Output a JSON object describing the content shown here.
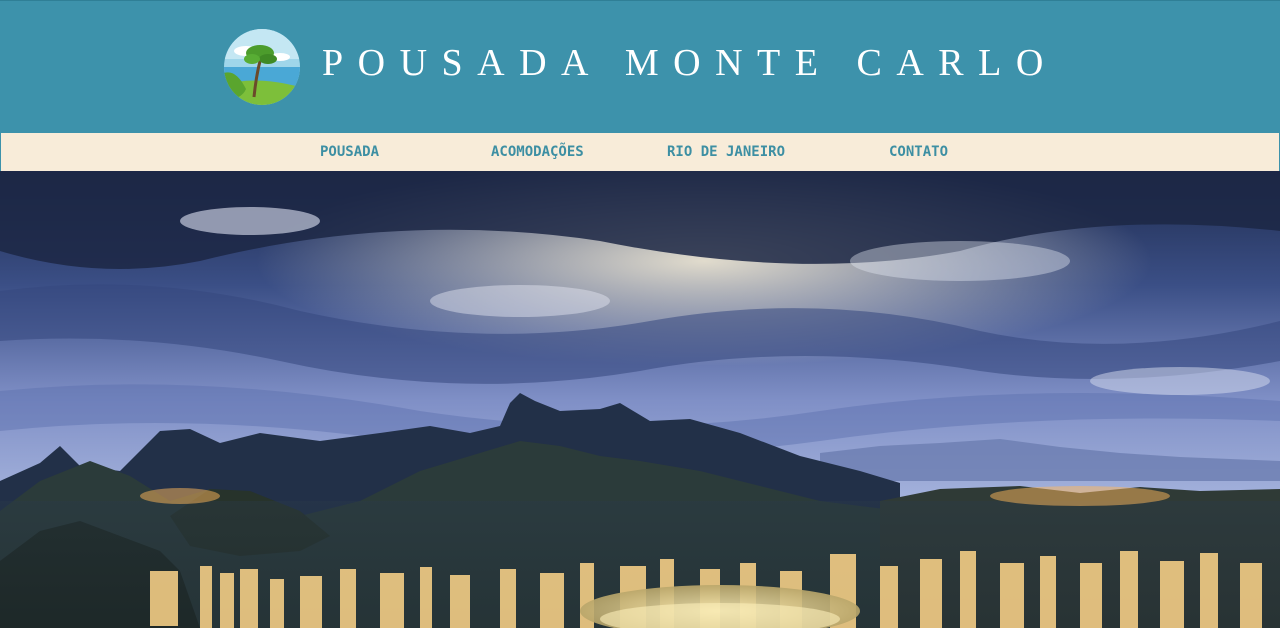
{
  "header": {
    "title": "POUSADA MONTE CARLO",
    "logo_icon": "beach-tree-logo-icon",
    "background_color": "#3d92ab",
    "title_color": "#ffffff"
  },
  "nav": {
    "background_color": "#f8ecd9",
    "text_color": "#3d8fa3",
    "items": [
      {
        "label": "POUSADA"
      },
      {
        "label": "ACOMODAÇÕES"
      },
      {
        "label": "RIO DE JANEIRO"
      },
      {
        "label": "CONTATO"
      }
    ]
  },
  "hero": {
    "image": "rio-de-janeiro-dusk-panorama"
  }
}
